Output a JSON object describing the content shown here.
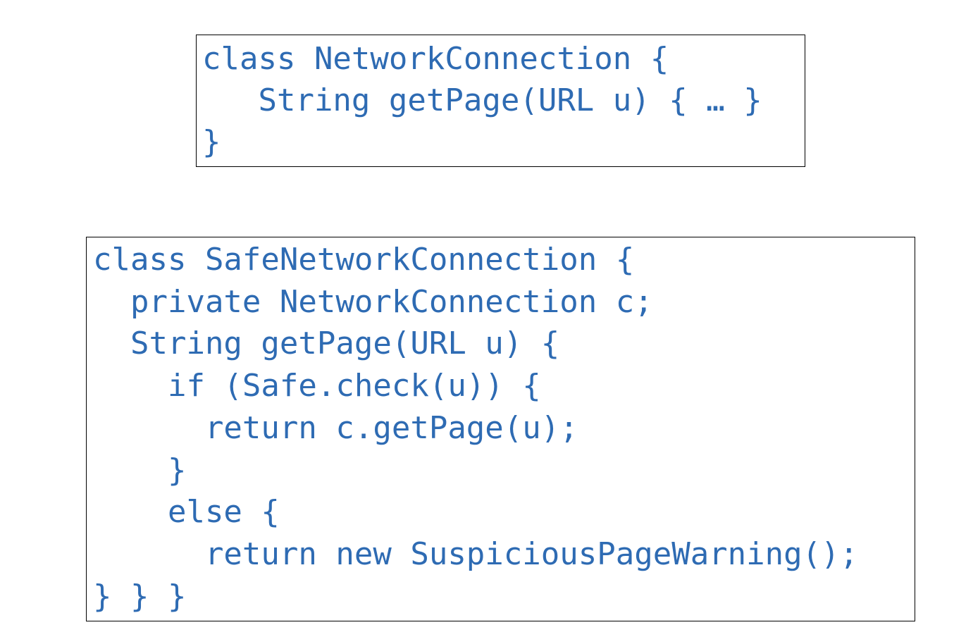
{
  "colors": {
    "code_text": "#2e6bb3",
    "border": "#000000",
    "background": "#ffffff"
  },
  "snippet_a": {
    "lines": [
      "class NetworkConnection {",
      "   String getPage(URL u) { … }",
      "}"
    ]
  },
  "snippet_b": {
    "lines": [
      "class SafeNetworkConnection {",
      "  private NetworkConnection c;",
      "  String getPage(URL u) {",
      "    if (Safe.check(u)) {",
      "      return c.getPage(u);",
      "    }",
      "    else {",
      "      return new SuspiciousPageWarning();",
      "} } }"
    ]
  }
}
